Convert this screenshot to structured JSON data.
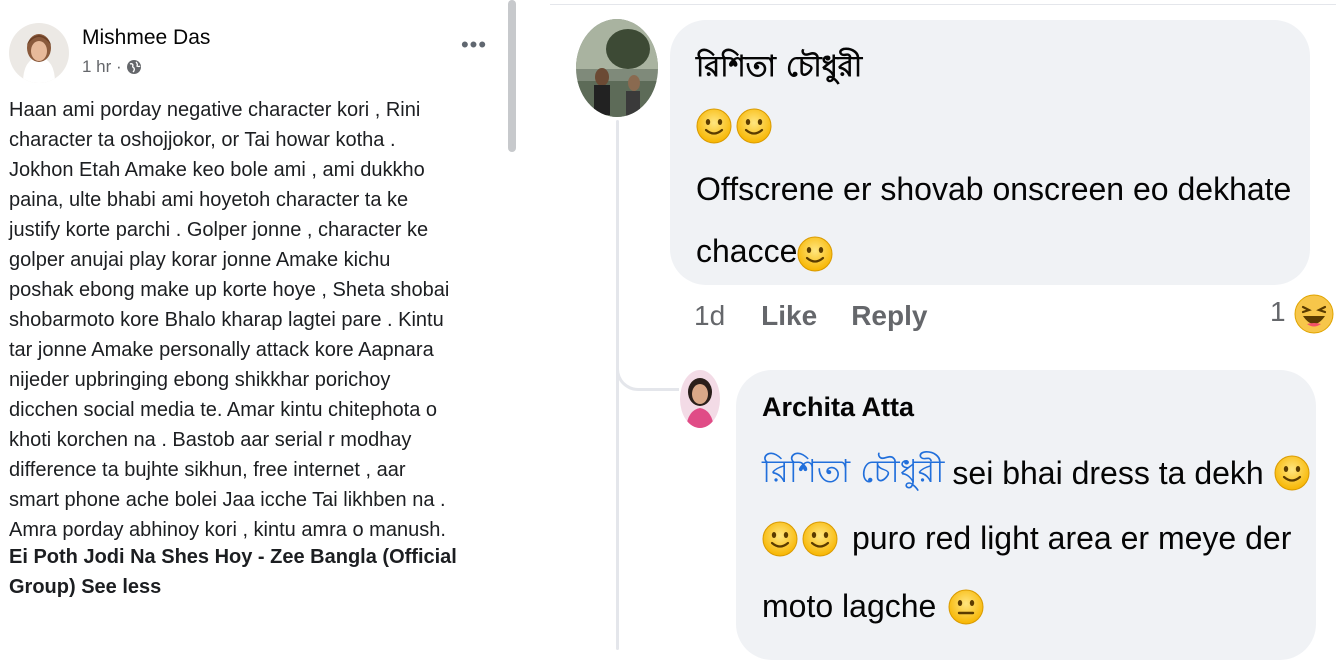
{
  "post": {
    "author": "Mishmee Das",
    "time": "1 hr ·",
    "body": "Haan ami porday negative character kori , Rini\ncharacter ta oshojjokor, or Tai howar kotha .\nJokhon Etah Amake keo bole ami , ami dukkho\npaina, ulte bhabi ami hoyetoh character ta ke\njustify korte parchi . Golper jonne , character ke\ngolper anujai play korar jonne Amake kichu\nposhak ebong make up korte hoye , Sheta shobai\nshobarmoto kore Bhalo kharap lagtei pare . Kintu\ntar jonne Amake personally attack kore Aapnara\nnijeder upbringing ebong shikkhar porichoy\ndicchen social media te. Amar kintu chitephota o\nkhoti korchen na . Bastob aar serial r modhay\ndifference ta bujhte sikhun, free internet , aar\nsmart phone ache bolei Jaa icche Tai likhben na .\nAmra porday abhinoy kori , kintu amra o manush.",
    "group": "Ei Poth Jodi Na Shes Hoy - Zee Bangla (Official Group)",
    "see_less": "See less",
    "more_icon": "more-options-icon",
    "privacy_icon": "globe-icon"
  },
  "comment1": {
    "author": "রিশিতা চৌধুরী",
    "text": "Offscrene er shovab onscreen eo dekhate chacce",
    "time": "1d",
    "like": "Like",
    "reply": "Reply",
    "reaction_count": "1",
    "reaction_icon": "haha-reaction-icon"
  },
  "comment2": {
    "author": "Archita Atta",
    "mention": "রিশিতা চৌধুরী",
    "line1": "sei bhai dress ta dekh",
    "line2": "puro red light area er meye der",
    "line3": "moto lagche"
  },
  "colors": {
    "bubble": "#f0f2f5",
    "mention": "#216fdb",
    "muted": "#65676b",
    "text": "#050505"
  }
}
